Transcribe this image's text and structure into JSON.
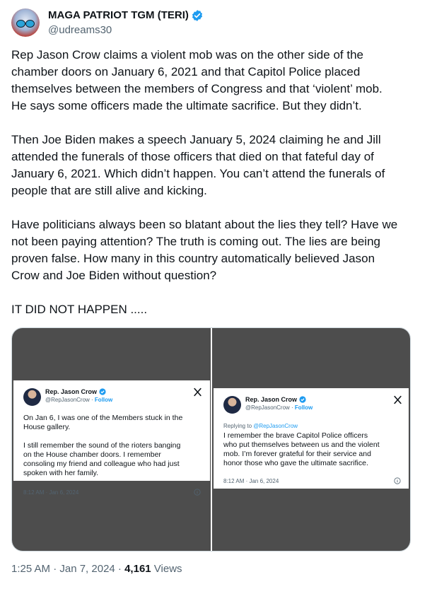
{
  "tweet": {
    "display_name": "MAGA PATRIOT TGM (TERI)",
    "handle": "@udreams30",
    "text": "Rep Jason Crow claims a violent mob was on the other side of the\nchamber doors on January 6, 2021 and that Capitol Police placed\nthemselves between the members of Congress and that ‘violent’ mob.\nHe says some officers made the ultimate sacrifice. But they didn’t.\n\nThen Joe Biden makes a speech January 5, 2024 claiming he and Jill\nattended the funerals of those officers that died on that fateful day of\nJanuary 6, 2021. Which didn’t happen. You can’t attend the funerals of\npeople that are still alive and kicking.\n\nHave politicians always been so blatant about the lies they tell? Have we\nnot been paying attention? The truth is coming out. The lies are being\nproven false. How many in this country automatically believed Jason\nCrow and Joe Biden without question?\n\nIT DID NOT HAPPEN .....",
    "timestamp": "1:25 AM · Jan 7, 2024 · ",
    "views_count": "4,161",
    "views_label": " Views",
    "verified_color": "#1d9bf0"
  },
  "media": [
    {
      "name": "Rep. Jason Crow",
      "handle": "@RepJasonCrow · ",
      "follow": "Follow",
      "text": "On Jan 6, I was one of the Members stuck in the\nHouse gallery.\n\nI still remember the sound of the rioters banging\non the House chamber doors. I remember\nconsoling my friend and colleague who had just\nspoken with her family.",
      "time": "8:12 AM · Jan 6, 2024"
    },
    {
      "name": "Rep. Jason Crow",
      "handle": "@RepJasonCrow · ",
      "follow": "Follow",
      "replying_prefix": "Replying to ",
      "replying_to": "@RepJasonCrow",
      "text": "I remember the brave Capitol Police officers\nwho put themselves between us and the violent\nmob. I’m forever grateful for their service and\nhonor those who gave the ultimate sacrifice.",
      "time": "8:12 AM · Jan 6, 2024"
    }
  ]
}
